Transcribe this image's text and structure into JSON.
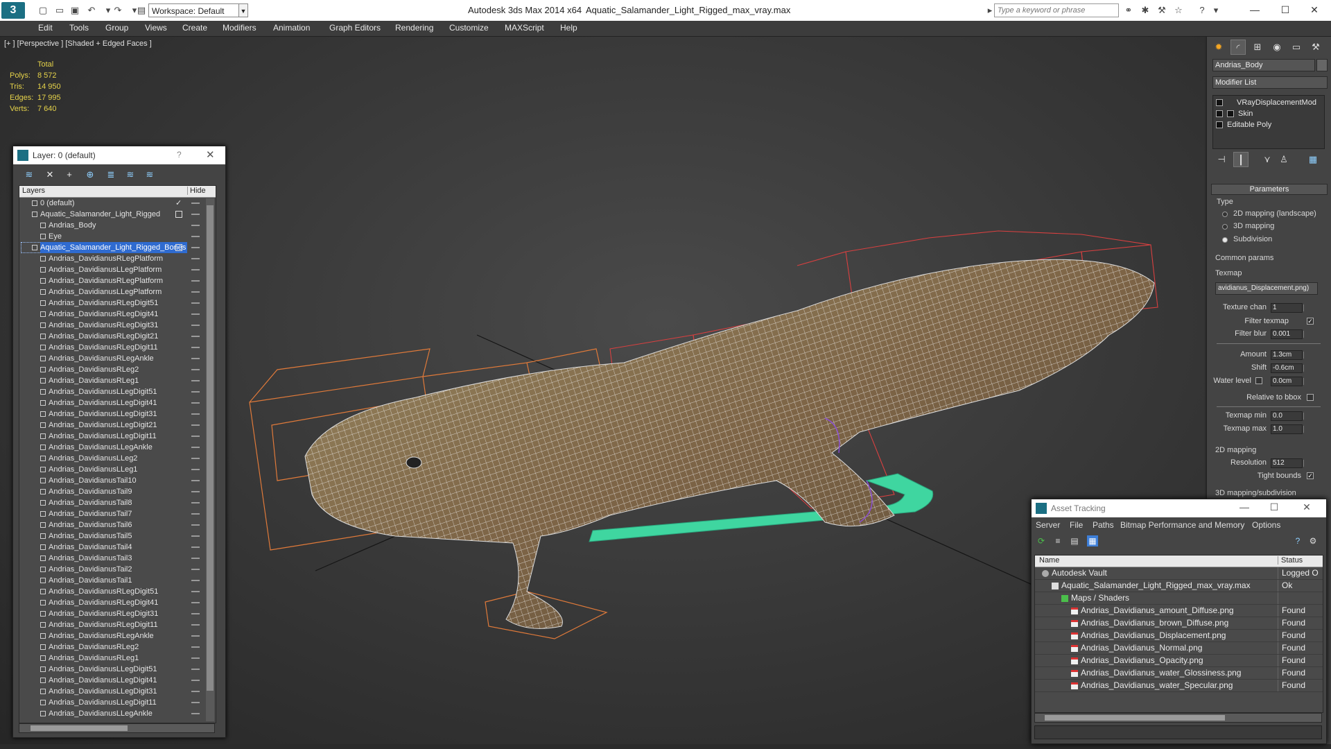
{
  "titlebar": {
    "workspace": "Workspace: Default",
    "app_title": "Autodesk 3ds Max  2014 x64",
    "file_title": "Aquatic_Salamander_Light_Rigged_max_vray.max",
    "search_placeholder": "Type a keyword or phrase"
  },
  "menu": [
    "Edit",
    "Tools",
    "Group",
    "Views",
    "Create",
    "Modifiers",
    "Animation",
    "Graph Editors",
    "Rendering",
    "Customize",
    "MAXScript",
    "Help"
  ],
  "viewport": {
    "label": "[+ ] [Perspective ] [Shaded + Edged Faces ]",
    "stats": {
      "header": "Total",
      "rows": [
        {
          "k": "Polys:",
          "v": "8 572"
        },
        {
          "k": "Tris:",
          "v": "14 950"
        },
        {
          "k": "Edges:",
          "v": "17 995"
        },
        {
          "k": "Verts:",
          "v": "7 640"
        }
      ]
    }
  },
  "layer_dialog": {
    "title": "Layer: 0 (default)",
    "help": "?",
    "col_layers": "Layers",
    "col_hide": "Hide",
    "rows": [
      {
        "name": "0 (default)",
        "level": 1,
        "type": "layer",
        "check": true
      },
      {
        "name": "Aquatic_Salamander_Light_Rigged",
        "level": 1,
        "type": "layer",
        "box": true
      },
      {
        "name": "Andrias_Body",
        "level": 2,
        "type": "obj"
      },
      {
        "name": "Eye",
        "level": 2,
        "type": "obj"
      },
      {
        "name": "Aquatic_Salamander_Light_Rigged_Bones",
        "level": 1,
        "type": "layer",
        "box": true,
        "selected": true
      },
      {
        "name": "Andrias_DavidianusRLegPlatform",
        "level": 2,
        "type": "obj"
      },
      {
        "name": "Andrias_DavidianusLLegPlatform",
        "level": 2,
        "type": "obj"
      },
      {
        "name": "Andrias_DavidianusRLegPlatform",
        "level": 2,
        "type": "obj"
      },
      {
        "name": "Andrias_DavidianusLLegPlatform",
        "level": 2,
        "type": "obj"
      },
      {
        "name": "Andrias_DavidianusRLegDigit51",
        "level": 2,
        "type": "obj"
      },
      {
        "name": "Andrias_DavidianusRLegDigit41",
        "level": 2,
        "type": "obj"
      },
      {
        "name": "Andrias_DavidianusRLegDigit31",
        "level": 2,
        "type": "obj"
      },
      {
        "name": "Andrias_DavidianusRLegDigit21",
        "level": 2,
        "type": "obj"
      },
      {
        "name": "Andrias_DavidianusRLegDigit11",
        "level": 2,
        "type": "obj"
      },
      {
        "name": "Andrias_DavidianusRLegAnkle",
        "level": 2,
        "type": "obj"
      },
      {
        "name": "Andrias_DavidianusRLeg2",
        "level": 2,
        "type": "obj"
      },
      {
        "name": "Andrias_DavidianusRLeg1",
        "level": 2,
        "type": "obj"
      },
      {
        "name": "Andrias_DavidianusLLegDigit51",
        "level": 2,
        "type": "obj"
      },
      {
        "name": "Andrias_DavidianusLLegDigit41",
        "level": 2,
        "type": "obj"
      },
      {
        "name": "Andrias_DavidianusLLegDigit31",
        "level": 2,
        "type": "obj"
      },
      {
        "name": "Andrias_DavidianusLLegDigit21",
        "level": 2,
        "type": "obj"
      },
      {
        "name": "Andrias_DavidianusLLegDigit11",
        "level": 2,
        "type": "obj"
      },
      {
        "name": "Andrias_DavidianusLLegAnkle",
        "level": 2,
        "type": "obj"
      },
      {
        "name": "Andrias_DavidianusLLeg2",
        "level": 2,
        "type": "obj"
      },
      {
        "name": "Andrias_DavidianusLLeg1",
        "level": 2,
        "type": "obj"
      },
      {
        "name": "Andrias_DavidianusTail10",
        "level": 2,
        "type": "obj"
      },
      {
        "name": "Andrias_DavidianusTail9",
        "level": 2,
        "type": "obj"
      },
      {
        "name": "Andrias_DavidianusTail8",
        "level": 2,
        "type": "obj"
      },
      {
        "name": "Andrias_DavidianusTail7",
        "level": 2,
        "type": "obj"
      },
      {
        "name": "Andrias_DavidianusTail6",
        "level": 2,
        "type": "obj"
      },
      {
        "name": "Andrias_DavidianusTail5",
        "level": 2,
        "type": "obj"
      },
      {
        "name": "Andrias_DavidianusTail4",
        "level": 2,
        "type": "obj"
      },
      {
        "name": "Andrias_DavidianusTail3",
        "level": 2,
        "type": "obj"
      },
      {
        "name": "Andrias_DavidianusTail2",
        "level": 2,
        "type": "obj"
      },
      {
        "name": "Andrias_DavidianusTail1",
        "level": 2,
        "type": "obj"
      },
      {
        "name": "Andrias_DavidianusRLegDigit51",
        "level": 2,
        "type": "obj"
      },
      {
        "name": "Andrias_DavidianusRLegDigit41",
        "level": 2,
        "type": "obj"
      },
      {
        "name": "Andrias_DavidianusRLegDigit31",
        "level": 2,
        "type": "obj"
      },
      {
        "name": "Andrias_DavidianusRLegDigit11",
        "level": 2,
        "type": "obj"
      },
      {
        "name": "Andrias_DavidianusRLegAnkle",
        "level": 2,
        "type": "obj"
      },
      {
        "name": "Andrias_DavidianusRLeg2",
        "level": 2,
        "type": "obj"
      },
      {
        "name": "Andrias_DavidianusRLeg1",
        "level": 2,
        "type": "obj"
      },
      {
        "name": "Andrias_DavidianusLLegDigit51",
        "level": 2,
        "type": "obj"
      },
      {
        "name": "Andrias_DavidianusLLegDigit41",
        "level": 2,
        "type": "obj"
      },
      {
        "name": "Andrias_DavidianusLLegDigit31",
        "level": 2,
        "type": "obj"
      },
      {
        "name": "Andrias_DavidianusLLegDigit11",
        "level": 2,
        "type": "obj"
      },
      {
        "name": "Andrias_DavidianusLLegAnkle",
        "level": 2,
        "type": "obj"
      }
    ]
  },
  "command_panel": {
    "object_name": "Andrias_Body",
    "modifier_list": "Modifier List",
    "stack": [
      "VRayDisplacementMod",
      "Skin",
      "Editable Poly"
    ],
    "parameters_title": "Parameters",
    "type_label": "Type",
    "type_options": [
      {
        "label": "2D mapping (landscape)",
        "on": false
      },
      {
        "label": "3D mapping",
        "on": false
      },
      {
        "label": "Subdivision",
        "on": true
      }
    ],
    "common_params": "Common params",
    "texmap_label": "Texmap",
    "texmap_value": "avidianus_Displacement.png)",
    "params": [
      {
        "label": "Texture chan",
        "value": "1"
      },
      {
        "label": "Filter texmap",
        "check": true
      },
      {
        "label": "Filter blur",
        "value": "0.001"
      },
      {
        "label": "Amount",
        "value": "1.3cm"
      },
      {
        "label": "Shift",
        "value": "-0.6cm"
      },
      {
        "label": "Water level",
        "value": "0.0cm"
      },
      {
        "label": "Relative to bbox",
        "check": false
      },
      {
        "label": "Texmap min",
        "value": "0.0"
      },
      {
        "label": "Texmap max",
        "value": "1.0"
      }
    ],
    "mapping2d": "2D mapping",
    "resolution_label": "Resolution",
    "resolution_value": "512",
    "tight_bounds": "Tight bounds",
    "mapping3d": "3D mapping/subdivision"
  },
  "asset_tracking": {
    "title": "Asset Tracking",
    "menu": [
      "Server",
      "File",
      "Paths",
      "Bitmap Performance and Memory",
      "Options"
    ],
    "col_name": "Name",
    "col_status": "Status",
    "rows": [
      {
        "name": "Autodesk Vault",
        "status": "Logged O",
        "level": 0,
        "icon": "vault"
      },
      {
        "name": "Aquatic_Salamander_Light_Rigged_max_vray.max",
        "status": "Ok",
        "level": 1,
        "icon": "file"
      },
      {
        "name": "Maps / Shaders",
        "status": "",
        "level": 2,
        "icon": "fold"
      },
      {
        "name": "Andrias_Davidianus_amount_Diffuse.png",
        "status": "Found",
        "level": 3,
        "icon": "png"
      },
      {
        "name": "Andrias_Davidianus_brown_Diffuse.png",
        "status": "Found",
        "level": 3,
        "icon": "png"
      },
      {
        "name": "Andrias_Davidianus_Displacement.png",
        "status": "Found",
        "level": 3,
        "icon": "png"
      },
      {
        "name": "Andrias_Davidianus_Normal.png",
        "status": "Found",
        "level": 3,
        "icon": "png"
      },
      {
        "name": "Andrias_Davidianus_Opacity.png",
        "status": "Found",
        "level": 3,
        "icon": "png"
      },
      {
        "name": "Andrias_Davidianus_water_Glossiness.png",
        "status": "Found",
        "level": 3,
        "icon": "png"
      },
      {
        "name": "Andrias_Davidianus_water_Specular.png",
        "status": "Found",
        "level": 3,
        "icon": "png"
      }
    ]
  },
  "colors": {
    "accent": "#1b6f83",
    "selection": "#2f6bd0",
    "stats": "#e6d34a",
    "mesh": "#8a7350",
    "bone_box": "#e05a3a",
    "platform": "#3fd6a0"
  }
}
